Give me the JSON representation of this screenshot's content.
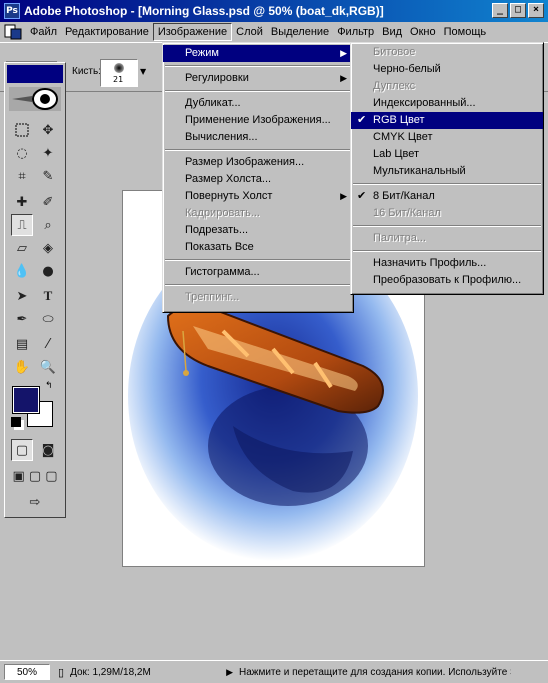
{
  "titlebar": {
    "title": "Adobe Photoshop - [Morning Glass.psd @ 50% (boat_dk,RGB)]",
    "icon": "photoshop-icon",
    "min": "_",
    "max": "□",
    "close": "×"
  },
  "menubar": {
    "items": [
      "Файл",
      "Редактирование",
      "Изображение",
      "Слой",
      "Выделение",
      "Фильтр",
      "Вид",
      "Окно",
      "Помощь"
    ],
    "active": "Изображение"
  },
  "optbar": {
    "brush_label": "Кисть:",
    "brush_size": "21"
  },
  "image_menu": {
    "items": [
      {
        "label": "Режим",
        "submenu": true,
        "highlighted": true
      },
      {
        "label": "Регулировки",
        "submenu": true
      },
      {
        "label": "Дубликат..."
      },
      {
        "label": "Применение Изображения..."
      },
      {
        "label": "Вычисления..."
      },
      {
        "label": "Размер Изображения..."
      },
      {
        "label": "Размер Холста..."
      },
      {
        "label": "Повернуть Холст",
        "submenu": true
      },
      {
        "label": "Кадрировать...",
        "disabled": true
      },
      {
        "label": "Подрезать..."
      },
      {
        "label": "Показать Все"
      },
      {
        "label": "Гистограмма..."
      },
      {
        "label": "Треппинг...",
        "disabled": true
      }
    ]
  },
  "mode_menu": {
    "items": [
      {
        "label": "Битовое",
        "disabled": true
      },
      {
        "label": "Черно-белый"
      },
      {
        "label": "Дуплекс",
        "disabled": true
      },
      {
        "label": "Индексированный..."
      },
      {
        "label": "RGB Цвет",
        "checked": true,
        "highlighted": true
      },
      {
        "label": "CMYK Цвет"
      },
      {
        "label": "Lab Цвет"
      },
      {
        "label": "Мультиканальный"
      },
      {
        "label": "8 Бит/Канал",
        "checked": true
      },
      {
        "label": "16 Бит/Канал",
        "disabled": true
      },
      {
        "label": "Палитра...",
        "disabled": true
      },
      {
        "label": "Назначить Профиль..."
      },
      {
        "label": "Преобразовать к Профилю..."
      }
    ]
  },
  "statusbar": {
    "zoom": "50%",
    "doc_info": "Док: 1,29M/18,2M",
    "hint": "Нажмите и перетащите для создания копии. Используйте Shift"
  },
  "colors": {
    "foreground": "#14146a",
    "background": "#ffffff",
    "accent": "#000080"
  }
}
